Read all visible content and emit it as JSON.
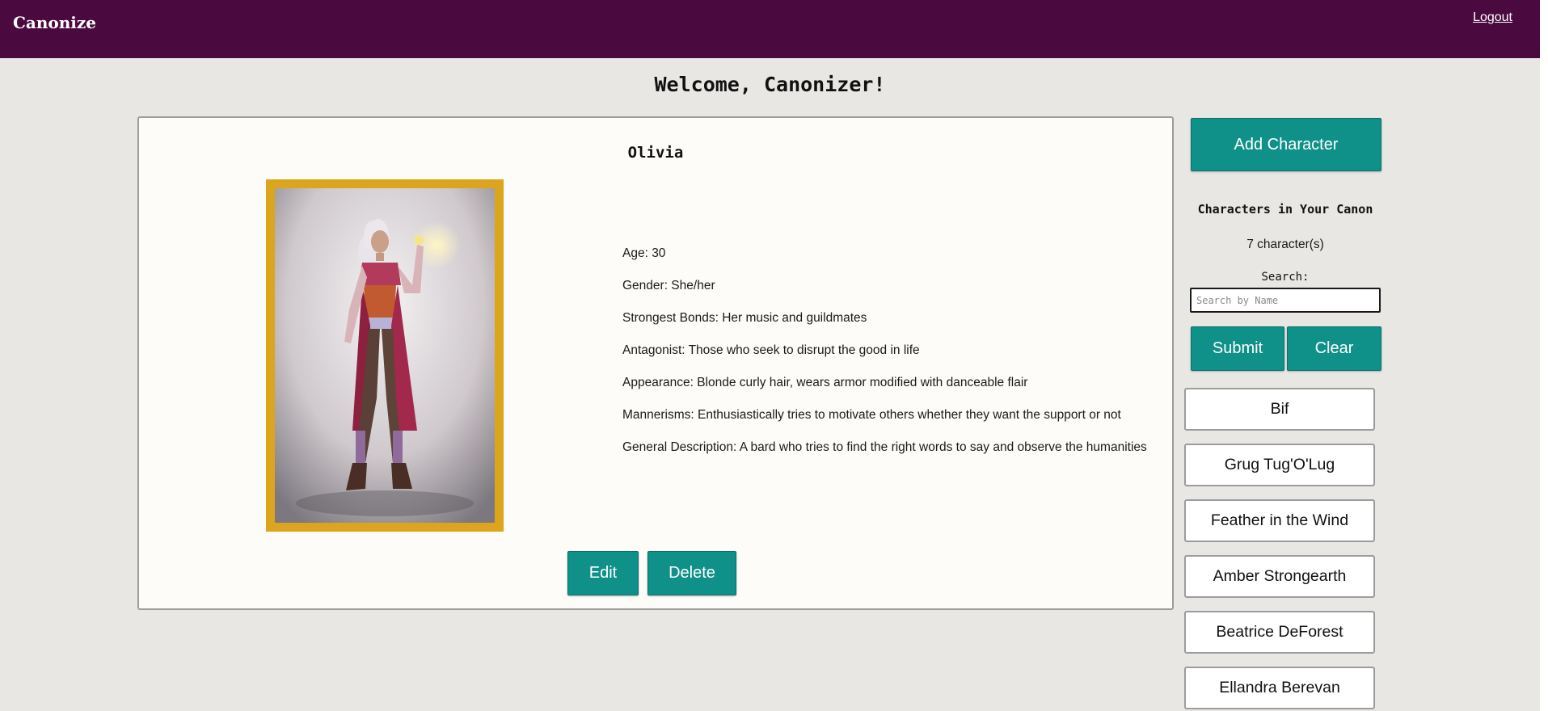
{
  "header": {
    "brand": "Canonize",
    "logout_label": "Logout"
  },
  "welcome": "Welcome, Canonizer!",
  "character": {
    "name": "Olivia",
    "details": [
      "Age: 30",
      "Gender: She/her",
      "Strongest Bonds: Her music and guildmates",
      "Antagonist: Those who seek to disrupt the good in life",
      "Appearance: Blonde curly hair, wears armor modified with danceable flair",
      "Mannerisms: Enthusiastically tries to motivate others whether they want the support or not",
      "General Description: A bard who tries to find the right words to say and observe the humanities"
    ],
    "edit_label": "Edit",
    "delete_label": "Delete"
  },
  "sidebar": {
    "add_label": "Add Character",
    "title": "Characters in Your Canon",
    "count": "7 character(s)",
    "search_label": "Search:",
    "search_placeholder": "Search by Name",
    "search_value": "",
    "submit_label": "Submit",
    "clear_label": "Clear",
    "characters": [
      "Bif",
      "Grug Tug'O'Lug",
      "Feather in the Wind",
      "Amber Strongearth",
      "Beatrice DeForest",
      "Ellandra Berevan"
    ]
  },
  "colors": {
    "header_bg": "#4a0a3f",
    "button_teal": "#0f9189",
    "frame_gold": "#dba51e",
    "page_bg": "#e8e7e4"
  }
}
